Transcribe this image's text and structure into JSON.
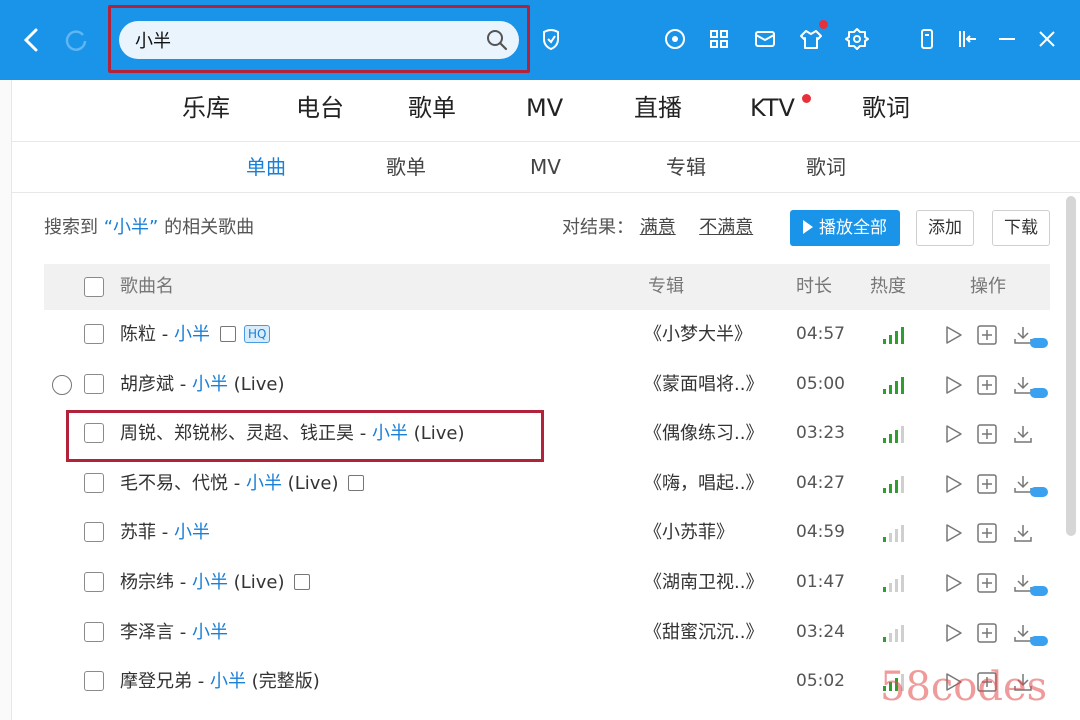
{
  "search": {
    "value": "小半"
  },
  "nav": {
    "items": [
      {
        "label": "乐库"
      },
      {
        "label": "电台"
      },
      {
        "label": "歌单"
      },
      {
        "label": "MV"
      },
      {
        "label": "直播"
      },
      {
        "label": "KTV"
      },
      {
        "label": "歌词"
      }
    ]
  },
  "sub_tabs": [
    {
      "label": "单曲"
    },
    {
      "label": "歌单"
    },
    {
      "label": "MV"
    },
    {
      "label": "专辑"
    },
    {
      "label": "歌词"
    }
  ],
  "summary": {
    "prefix": "搜索到",
    "keyword": "“小半”",
    "suffix": "的相关歌曲"
  },
  "feedback": {
    "label": "对结果：",
    "satisfied": "满意",
    "unsatisfied": "不满意"
  },
  "actions": {
    "play_all": "播放全部",
    "add": "添加",
    "download": "下载"
  },
  "table": {
    "headers": {
      "name": "歌曲名",
      "album": "专辑",
      "duration": "时长",
      "heat": "热度",
      "ops": "操作"
    },
    "rows": [
      {
        "artist": "陈粒",
        "sep": " - ",
        "song": "小半",
        "extra": "",
        "album": "《小梦大半》",
        "duration": "04:57",
        "heat_level": 4,
        "mv": true,
        "hq": "HQ",
        "cloud": true,
        "expand": false
      },
      {
        "artist": "胡彦斌",
        "sep": " - ",
        "song": "小半",
        "extra": " (Live)",
        "album": "《蒙面唱将..》",
        "duration": "05:00",
        "heat_level": 4,
        "mv": false,
        "hq": "",
        "cloud": true,
        "expand": true
      },
      {
        "artist": "周锐、郑锐彬、灵超、钱正昊",
        "sep": " - ",
        "song": "小半",
        "extra": " (Live)",
        "album": "《偶像练习..》",
        "duration": "03:23",
        "heat_level": 3,
        "mv": false,
        "hq": "",
        "cloud": false,
        "expand": false
      },
      {
        "artist": "毛不易、代悦",
        "sep": " - ",
        "song": "小半",
        "extra": " (Live)",
        "album": "《嗨，唱起..》",
        "duration": "04:27",
        "heat_level": 3,
        "mv": true,
        "hq": "",
        "cloud": true,
        "expand": false
      },
      {
        "artist": "苏菲",
        "sep": " - ",
        "song": "小半",
        "extra": "",
        "album": "《小苏菲》",
        "duration": "04:59",
        "heat_level": 1,
        "mv": false,
        "hq": "",
        "cloud": false,
        "expand": false
      },
      {
        "artist": "杨宗纬",
        "sep": " - ",
        "song": "小半",
        "extra": " (Live)",
        "album": "《湖南卫视..》",
        "duration": "01:47",
        "heat_level": 1,
        "mv": true,
        "hq": "",
        "cloud": true,
        "expand": false
      },
      {
        "artist": "李泽言",
        "sep": " - ",
        "song": "小半",
        "extra": "",
        "album": "《甜蜜沉沉..》",
        "duration": "03:24",
        "heat_level": 1,
        "mv": false,
        "hq": "",
        "cloud": true,
        "expand": false
      },
      {
        "artist": "摩登兄弟",
        "sep": " - ",
        "song": "小半",
        "extra": " (完整版)",
        "album": "",
        "duration": "05:02",
        "heat_level": 3,
        "mv": false,
        "hq": "",
        "cloud": false,
        "expand": false
      }
    ]
  },
  "colors": {
    "topbar": "#1a94e8",
    "accent": "#1a7fd6",
    "heat_on": "#2f9e2f",
    "heat_off": "#cfcfcf",
    "highlight": "#b0233a"
  },
  "watermark": "58codes"
}
